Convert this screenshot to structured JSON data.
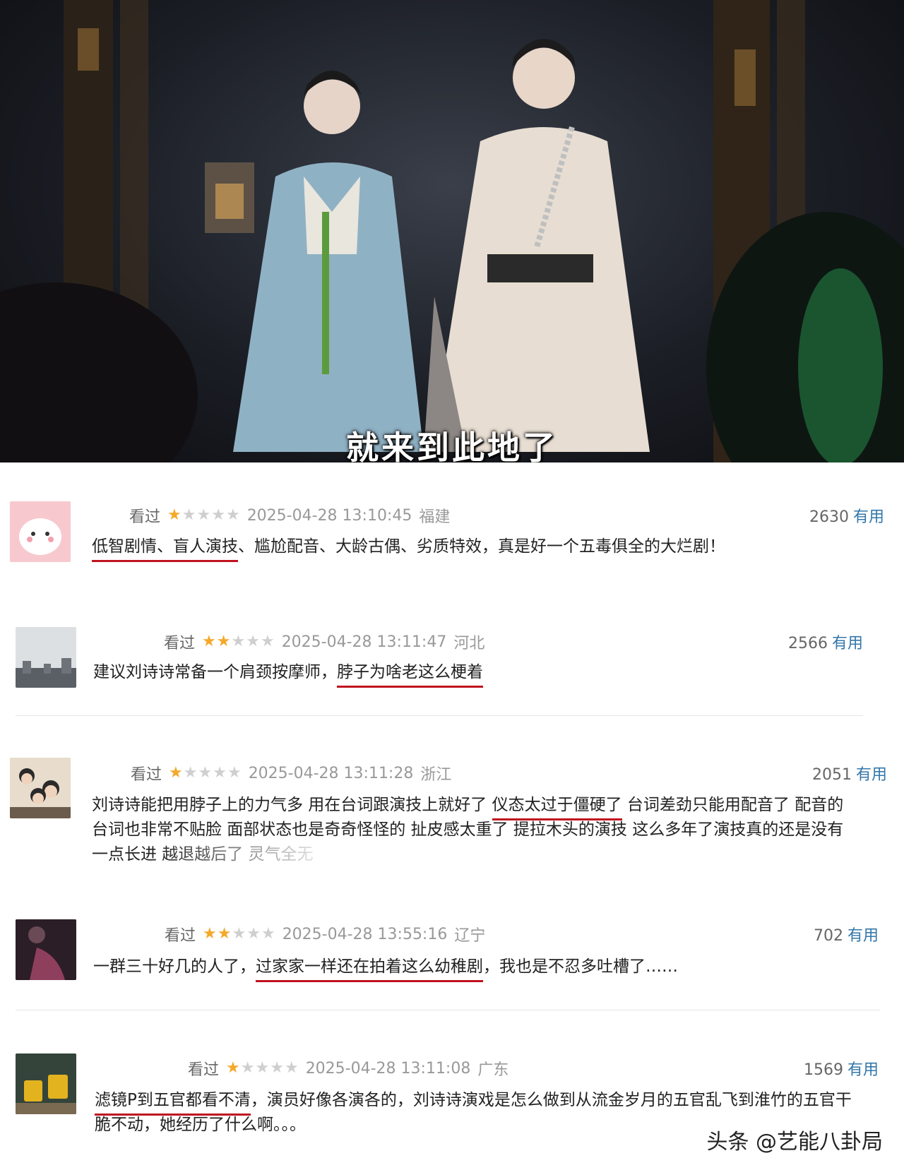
{
  "hero": {
    "subtitle": "就来到此地了"
  },
  "colors": {
    "star": "#f4a92a",
    "useful_link": "#3377aa",
    "underline": "#c0121f"
  },
  "reviews": [
    {
      "status": "看过",
      "rating": 1,
      "time": "2025-04-28 13:10:45",
      "location": "福建",
      "votes": "2630",
      "useful_label": "有用",
      "pre": "",
      "hl": "低智剧情、盲人演技",
      "post": "、尴尬配音、大龄古偶、劣质特效，真是好一个五毒俱全的大烂剧！"
    },
    {
      "status": "看过",
      "rating": 2,
      "time": "2025-04-28 13:11:47",
      "location": "河北",
      "votes": "2566",
      "useful_label": "有用",
      "pre": "建议刘诗诗常备一个肩颈按摩师，",
      "hl": "脖子为啥老这么梗着",
      "post": ""
    },
    {
      "status": "看过",
      "rating": 1,
      "time": "2025-04-28 13:11:28",
      "location": "浙江",
      "votes": "2051",
      "useful_label": "有用",
      "line1_pre": "刘诗诗能把用脖子上的力气多 用在台词跟演技上就好了 ",
      "line1_hl": "仪态太过于僵硬了",
      "line1_post": " 台词差劲只能用配音了 配音的",
      "line2": "台词也非常不贴脸 面部状态也是奇奇怪怪的 扯皮感太重了 提拉木头的演技 这么多年了演技真的还是没有",
      "line3": "一点长进 越退越后了 灵气全无"
    },
    {
      "status": "看过",
      "rating": 2,
      "time": "2025-04-28 13:55:16",
      "location": "辽宁",
      "votes": "702",
      "useful_label": "有用",
      "pre": "一群三十好几的人了，",
      "hl": "过家家一样还在拍着这么幼稚剧",
      "post": "，我也是不忍多吐槽了……"
    },
    {
      "status": "看过",
      "rating": 1,
      "time": "2025-04-28 13:11:08",
      "location": "广东",
      "votes": "1569",
      "useful_label": "有用",
      "line1_hl": "滤镜P到五官都看不清",
      "line1_post": "，演员好像各演各的，刘诗诗演戏是怎么做到从流金岁月的五官乱飞到淮竹的五官干",
      "line2": "脆不动，她经历了什么啊。。。"
    }
  ],
  "watermark": "头条 @艺能八卦局"
}
